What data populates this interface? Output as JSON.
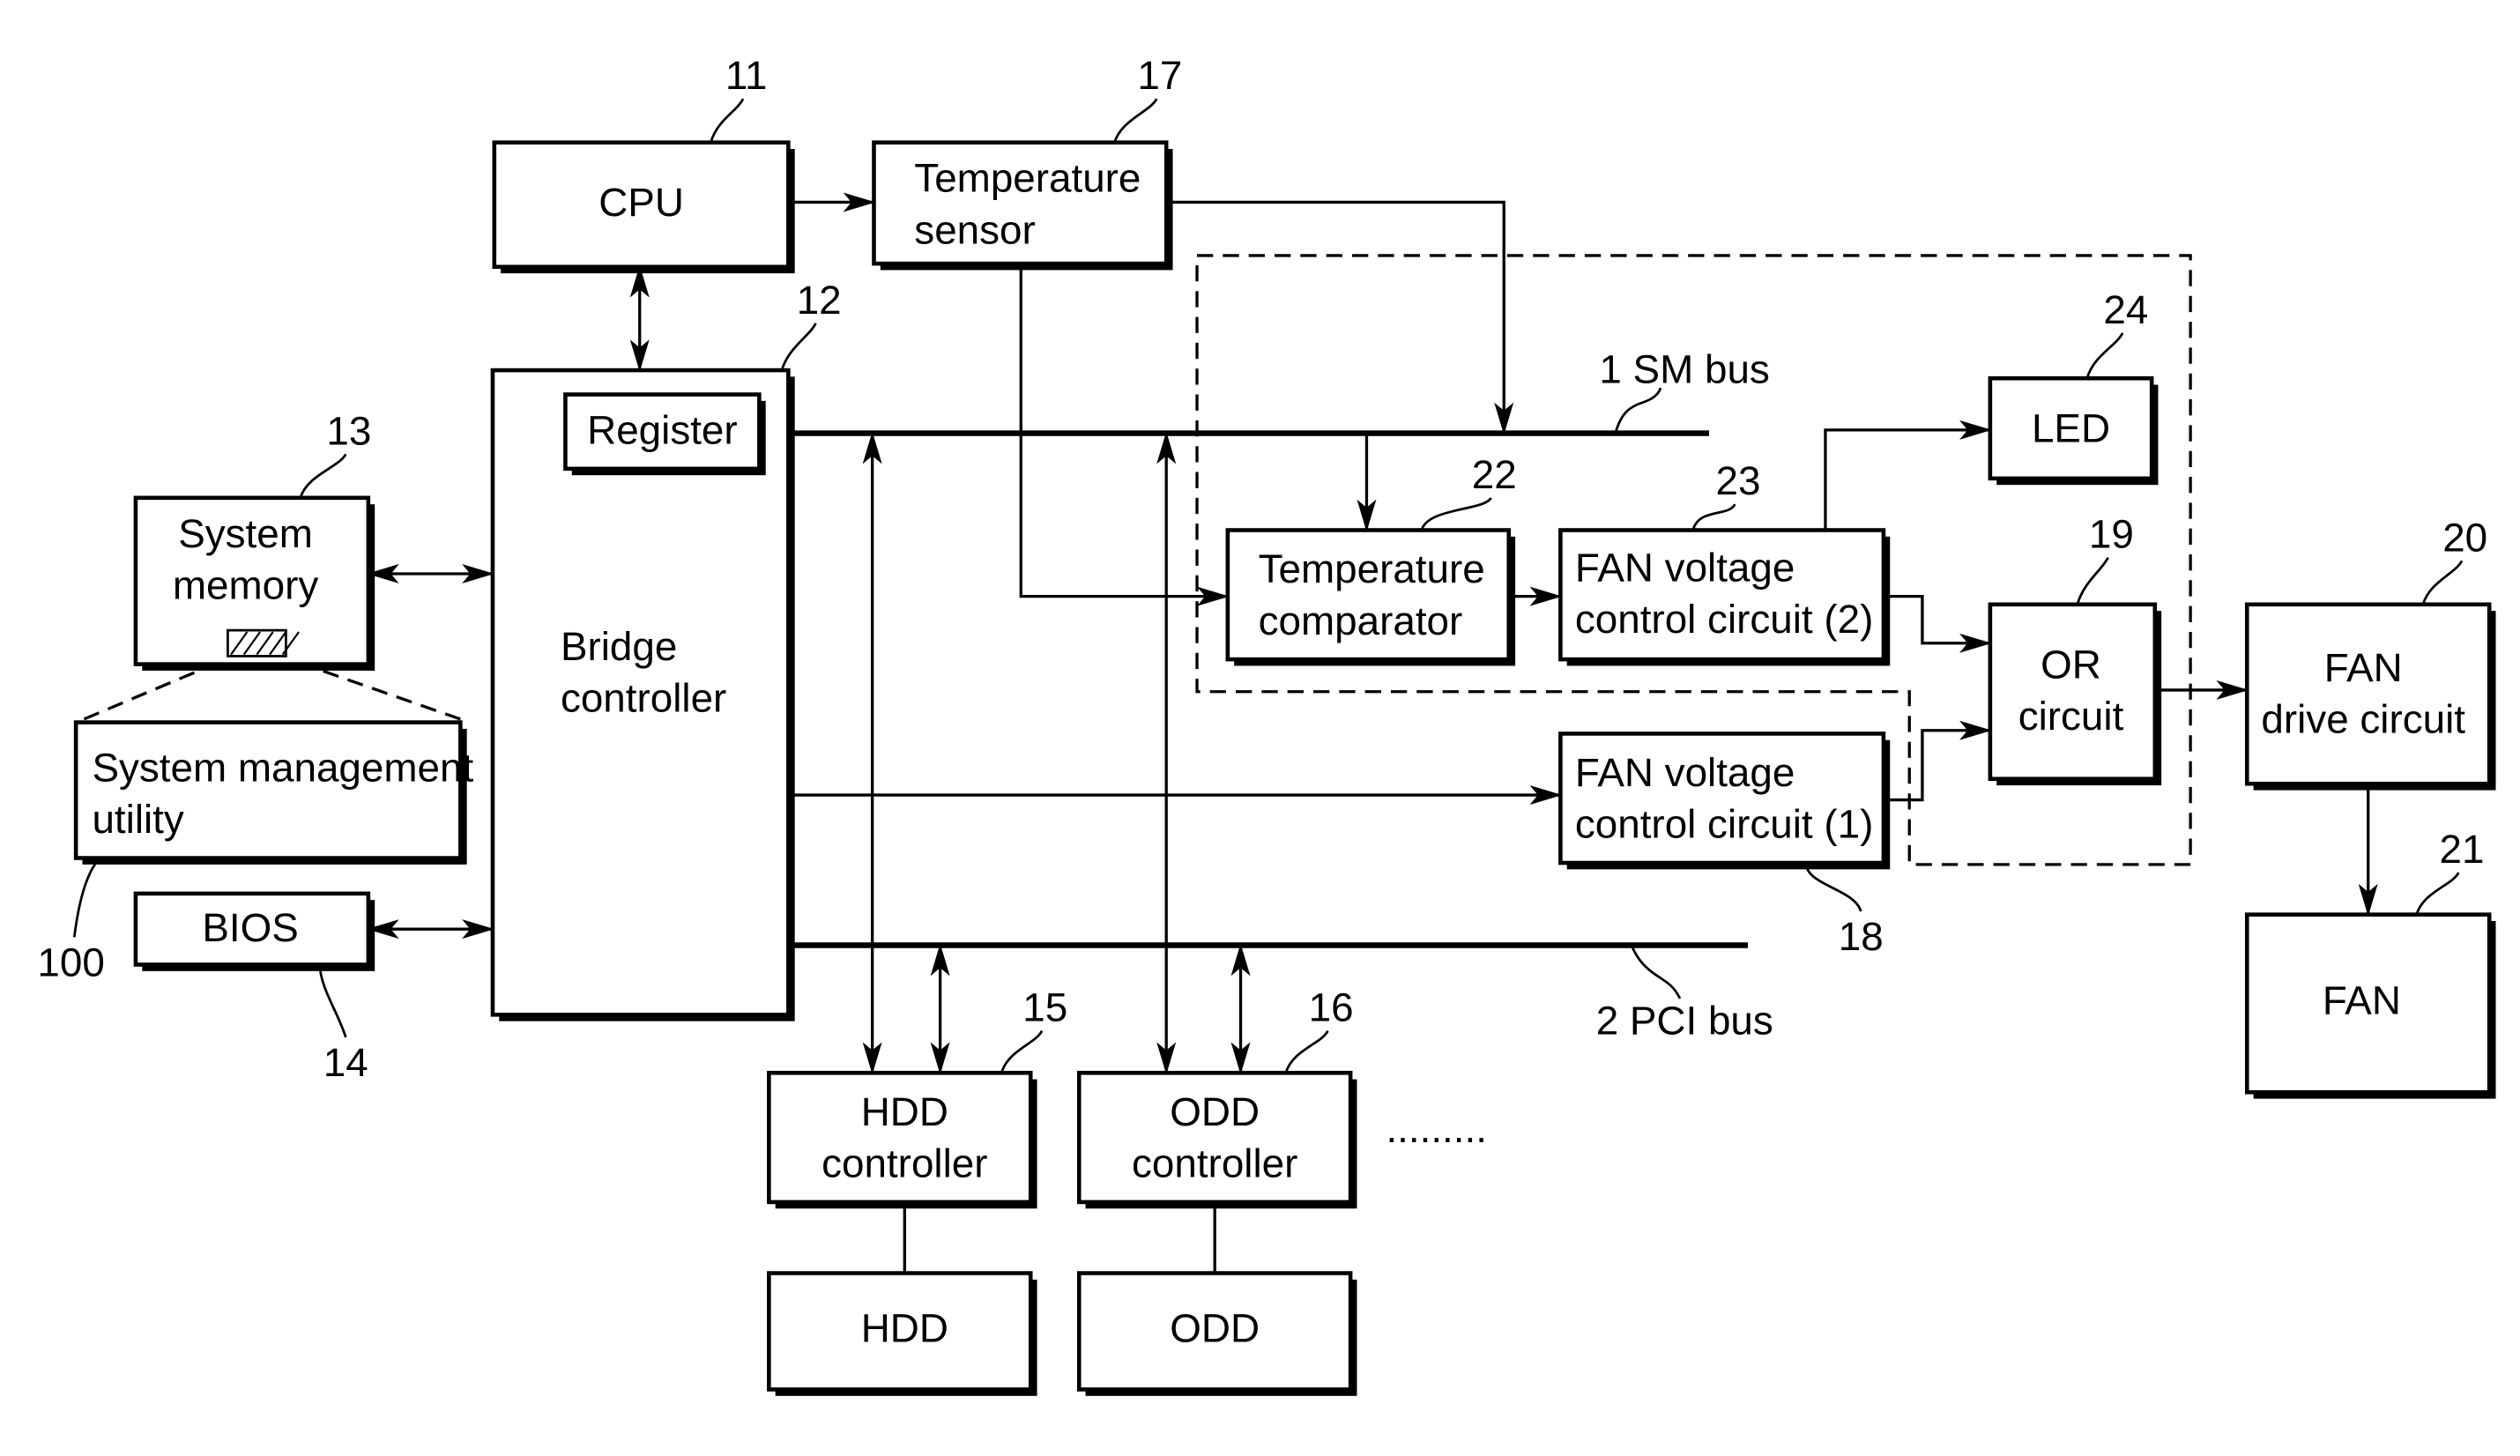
{
  "blocks": {
    "cpu": {
      "label": [
        "CPU"
      ],
      "ref": "11"
    },
    "bridge": {
      "label": [
        "Bridge",
        "controller"
      ],
      "ref": "12"
    },
    "register": {
      "label": [
        "Register"
      ]
    },
    "sysmem": {
      "label": [
        "System",
        "memory"
      ],
      "ref": "13"
    },
    "smu": {
      "label": [
        "System  management",
        "utility"
      ],
      "ref": "100"
    },
    "bios": {
      "label": [
        "BIOS"
      ],
      "ref": "14"
    },
    "tempsensor": {
      "label": [
        "Temperature",
        "sensor"
      ],
      "ref": "17"
    },
    "tempcomp": {
      "label": [
        "Temperature",
        "comparator"
      ],
      "ref": "22"
    },
    "fanv2": {
      "label": [
        "FAN  voltage",
        "control  circuit (2)"
      ],
      "ref": "23"
    },
    "fanv1": {
      "label": [
        "FAN  voltage",
        "control  circuit (1)"
      ],
      "ref": "18"
    },
    "led": {
      "label": [
        "LED"
      ],
      "ref": "24"
    },
    "or": {
      "label": [
        "OR",
        "circuit"
      ],
      "ref": "19"
    },
    "fandrive": {
      "label": [
        "FAN",
        "drive  circuit"
      ],
      "ref": "20"
    },
    "fan": {
      "label": [
        "FAN"
      ],
      "ref": "21"
    },
    "hddctl": {
      "label": [
        "HDD",
        "controller"
      ],
      "ref": "15"
    },
    "oddctl": {
      "label": [
        "ODD",
        "controller"
      ],
      "ref": "16"
    },
    "hdd": {
      "label": [
        "HDD"
      ]
    },
    "odd": {
      "label": [
        "ODD"
      ]
    }
  },
  "buses": {
    "sm": {
      "label": "1  SM  bus"
    },
    "pci": {
      "label": "2  PCI  bus"
    }
  },
  "ellipsis": "........."
}
